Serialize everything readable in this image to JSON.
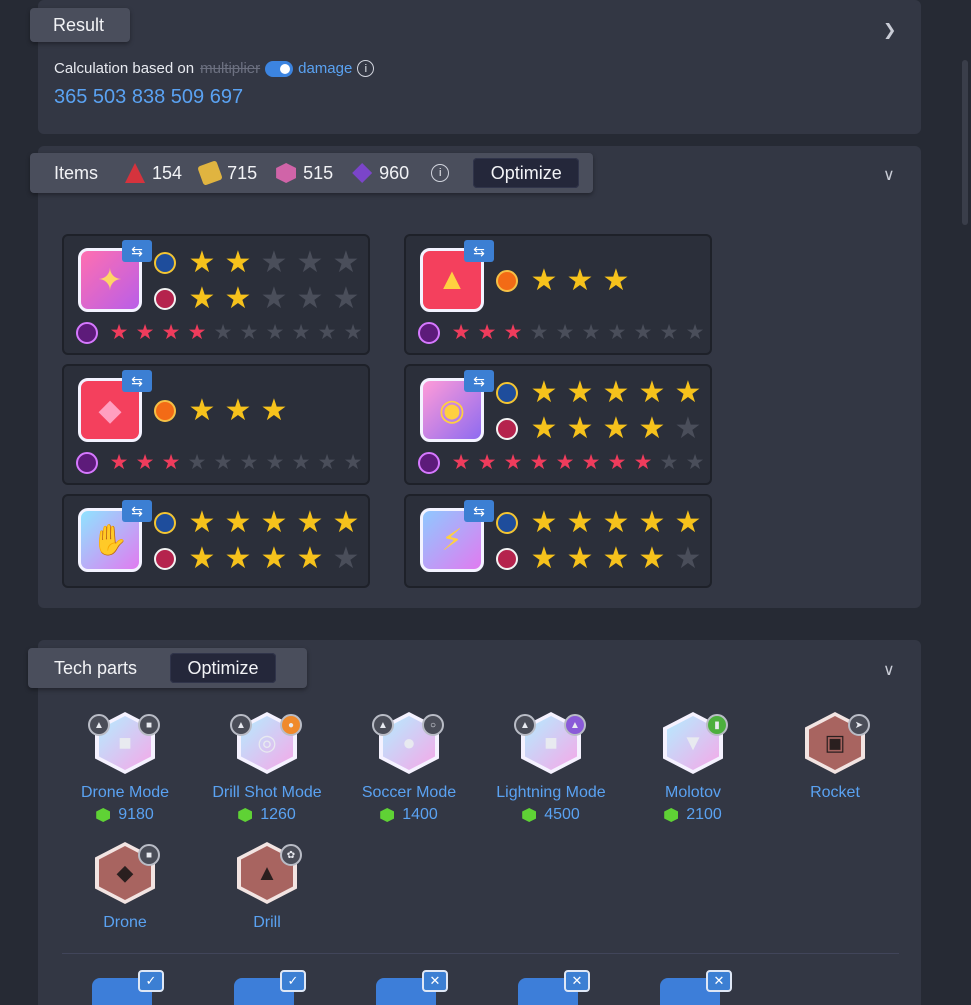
{
  "result": {
    "tab_label": "Result",
    "calc_prefix": "Calculation based on",
    "toggle_off_label": "multiplier",
    "toggle_on_label": "damage",
    "value": "365 503 838 509 697"
  },
  "items": {
    "tab_label": "Items",
    "resources": [
      {
        "icon": "red-shard-icon",
        "value": "154"
      },
      {
        "icon": "gold-scroll-icon",
        "value": "715"
      },
      {
        "icon": "pink-cube-icon",
        "value": "515"
      },
      {
        "icon": "purple-crystal-icon",
        "value": "960"
      }
    ],
    "optimize_label": "Optimize",
    "cards": [
      {
        "name": "magic-staff",
        "rows": [
          {
            "badge": "blue",
            "filled": 2,
            "total": 5
          },
          {
            "badge": "red",
            "filled": 2,
            "total": 5
          }
        ],
        "red_filled": 4,
        "red_total": 10
      },
      {
        "name": "mech-helmet",
        "rows": [
          {
            "badge": "orange",
            "filled": 3,
            "total": 3
          }
        ],
        "red_filled": 3,
        "red_total": 10
      },
      {
        "name": "chain-shield",
        "rows": [
          {
            "badge": "orange",
            "filled": 3,
            "total": 3
          }
        ],
        "red_filled": 3,
        "red_total": 10
      },
      {
        "name": "gem-belt",
        "rows": [
          {
            "badge": "blue",
            "filled": 5,
            "total": 5
          },
          {
            "badge": "red",
            "filled": 4,
            "total": 5
          }
        ],
        "red_filled": 8,
        "red_total": 10
      },
      {
        "name": "power-glove",
        "rows": [
          {
            "badge": "blue",
            "filled": 5,
            "total": 5
          },
          {
            "badge": "red",
            "filled": 4,
            "total": 5
          }
        ]
      },
      {
        "name": "speed-boot",
        "rows": [
          {
            "badge": "blue",
            "filled": 5,
            "total": 5
          },
          {
            "badge": "red",
            "filled": 4,
            "total": 5
          }
        ]
      }
    ]
  },
  "tech": {
    "tab_label": "Tech parts",
    "optimize_label": "Optimize",
    "parts": [
      {
        "name": "Drone Mode",
        "cost": "9180",
        "style": "rainbow"
      },
      {
        "name": "Drill Shot Mode",
        "cost": "1260",
        "style": "rainbow"
      },
      {
        "name": "Soccer Mode",
        "cost": "1400",
        "style": "rainbow"
      },
      {
        "name": "Lightning Mode",
        "cost": "4500",
        "style": "rainbow"
      },
      {
        "name": "Molotov",
        "cost": "2100",
        "style": "rainbow"
      },
      {
        "name": "Rocket",
        "cost": "",
        "style": "brown"
      },
      {
        "name": "Drone",
        "cost": "",
        "style": "brown"
      },
      {
        "name": "Drill",
        "cost": "",
        "style": "brown"
      }
    ]
  },
  "colors": {
    "accent": "#5aa2f2",
    "star": "#f6c21c",
    "red_star": "#ef3c5c",
    "panel": "#333744",
    "background": "#262a34"
  }
}
